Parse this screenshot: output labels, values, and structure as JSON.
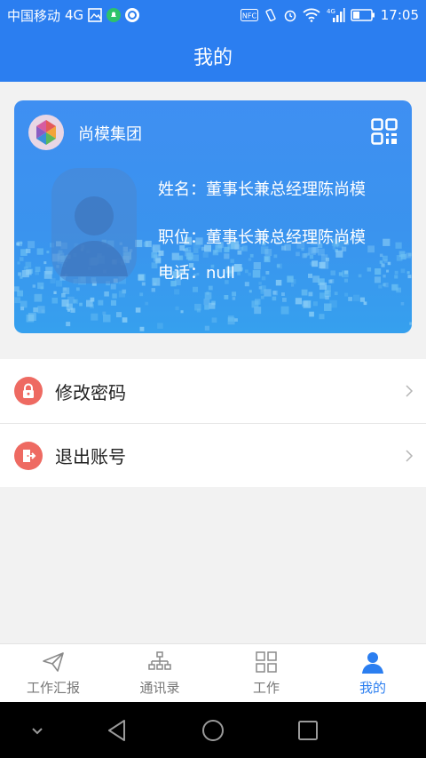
{
  "status_bar": {
    "carrier": "中国移动",
    "network": "4G",
    "time": "17:05",
    "nfc_label": "NFC",
    "signal_label": "4G"
  },
  "header": {
    "title": "我的"
  },
  "card": {
    "org_name": "尚模集团",
    "name_line": "姓名：董事长兼总经理陈尚模",
    "position_line": "职位：董事长兼总经理陈尚模",
    "phone_line": "电话：null"
  },
  "menu": {
    "items": [
      {
        "label": "修改密码",
        "icon": "lock-icon"
      },
      {
        "label": "退出账号",
        "icon": "logout-icon"
      }
    ]
  },
  "tabbar": {
    "items": [
      {
        "label": "工作汇报",
        "icon": "paper-plane-icon"
      },
      {
        "label": "通讯录",
        "icon": "org-chart-icon"
      },
      {
        "label": "工作",
        "icon": "grid-icon"
      },
      {
        "label": "我的",
        "icon": "user-icon",
        "active": true
      }
    ]
  },
  "colors": {
    "primary": "#2b7ef0",
    "menu_icon_bg": "#ee6a62",
    "inactive_tab": "#777777"
  }
}
